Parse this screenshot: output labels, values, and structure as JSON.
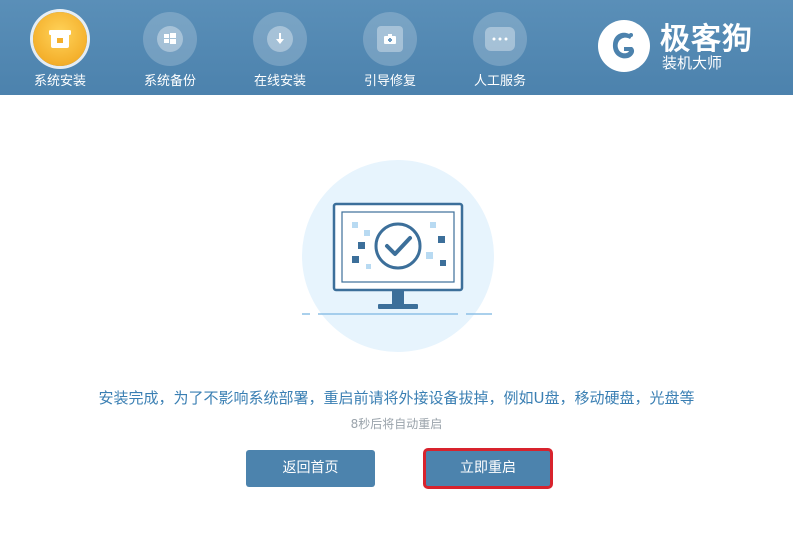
{
  "nav": [
    {
      "label": "系统安装",
      "icon": "box-icon",
      "active": true
    },
    {
      "label": "系统备份",
      "icon": "windows-backup-icon",
      "active": false
    },
    {
      "label": "在线安装",
      "icon": "download-icon",
      "active": false
    },
    {
      "label": "引导修复",
      "icon": "toolbox-icon",
      "active": false
    },
    {
      "label": "人工服务",
      "icon": "chat-icon",
      "active": false
    }
  ],
  "brand": {
    "title": "极客狗",
    "subtitle": "装机大师",
    "logo_icon": "g-dog-logo-icon"
  },
  "main": {
    "message": "安装完成，为了不影响系统部署，重启前请将外接设备拔掉，例如U盘，移动硬盘，光盘等",
    "countdown": "8秒后将自动重启",
    "back_label": "返回首页",
    "restart_label": "立即重启"
  },
  "colors": {
    "header": "#4c82ad",
    "accent": "#3a7fb3",
    "button": "#4c83ad",
    "highlight_border": "#d8232d",
    "active_icon": "#f4b02c"
  }
}
